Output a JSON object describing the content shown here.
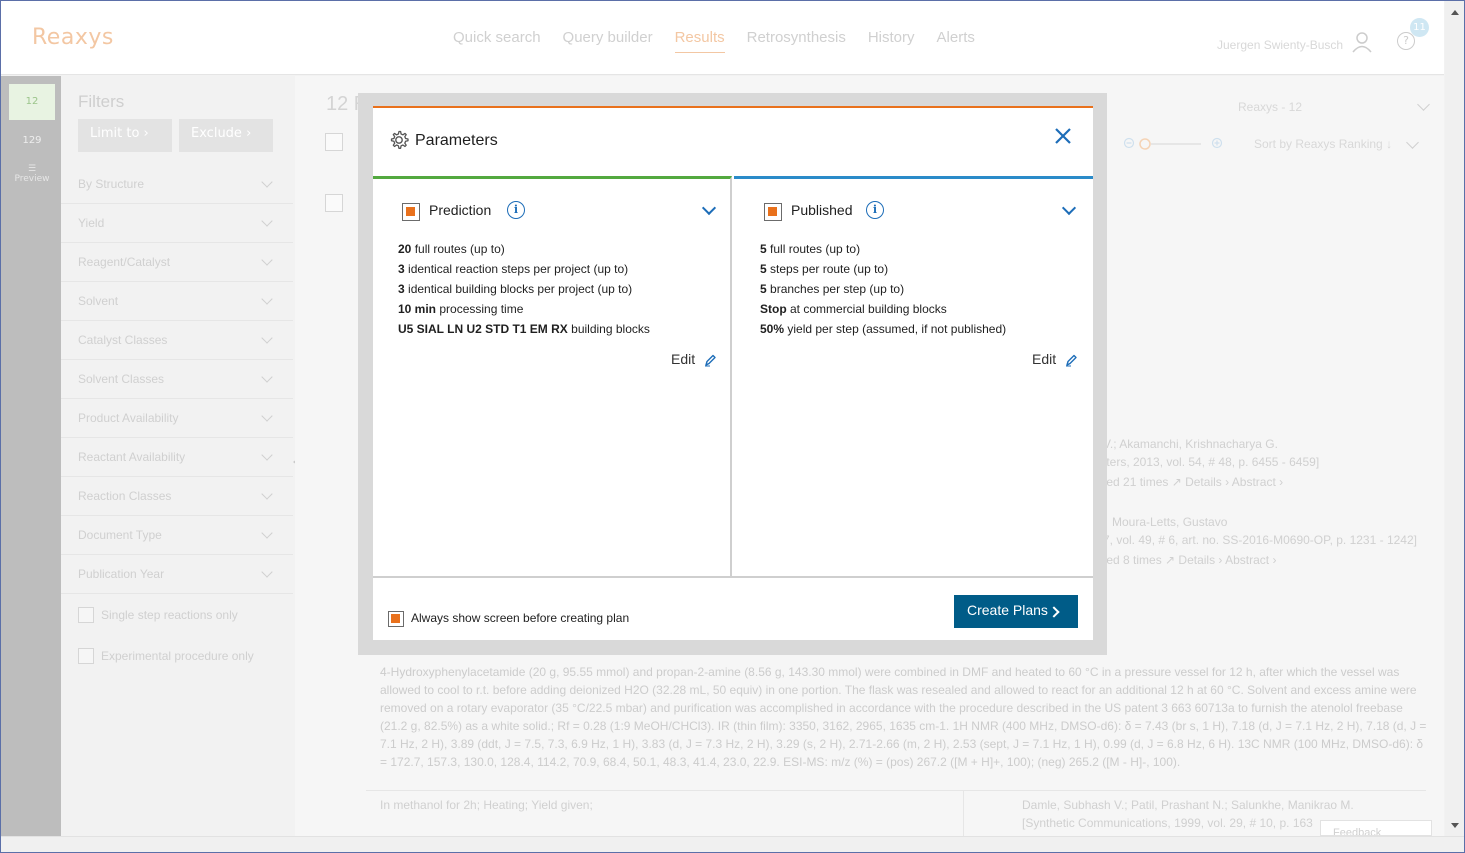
{
  "header": {
    "logo": "Reaxys",
    "nav": [
      "Quick search",
      "Query builder",
      "Results",
      "Retrosynthesis",
      "History",
      "Alerts"
    ],
    "active_nav": "Results",
    "user_name": "Juergen Swienty-Busch",
    "notification_count": "11"
  },
  "rail": {
    "tab1": "12",
    "tab2": "129",
    "preview": "Preview"
  },
  "filters": {
    "title": "Filters",
    "limit_button": "Limit to",
    "exclude_button": "Exclude",
    "items": [
      "By Structure",
      "Yield",
      "Reagent/Catalyst",
      "Solvent",
      "Catalyst Classes",
      "Solvent Classes",
      "Product Availability",
      "Reactant Availability",
      "Reaction Classes",
      "Document Type",
      "Publication Year"
    ],
    "checkboxes": [
      "Single step reactions only",
      "Experimental procedure only"
    ]
  },
  "results": {
    "count": "12 R",
    "source_select": "Reaxys - 12",
    "sort": "Sort by Reaxys Ranking",
    "authors1": "V.; Akamanchi, Krishnacharya G.",
    "citation1": "tters, 2013, vol. 54, # 48, p. 6455 - 6459]",
    "links1": "ted 21 times ↗    Details ›    Abstract ›",
    "authors2": "Moura-Letts, Gustavo",
    "citation2": "7, vol. 49, # 6, art. no. SS-2016-M0690-OP, p. 1231 - 1242]",
    "links2": "ted 8 times ↗    Details ›    Abstract ›",
    "procedure": "4-Hydroxyphenylacetamide (20 g, 95.55 mmol) and propan-2-amine (8.56 g, 143.30 mmol) were combined in DMF and heated to 60 °C in a pressure vessel for 12 h, after which the vessel was allowed to cool to r.t. before adding deionized H2O (32.28 mL, 50 equiv) in one portion. The flask was resealed and allowed to react for an additional 12 h at 60 °C. Solvent and excess amine were removed on a rotary evaporator (35 °C/22.5 mbar) and purification was accomplished in accordance with the procedure described in the US patent 3 663 60713a to furnish the atenolol freebase (21.2 g, 82.5%) as a white solid.; Rf = 0.28 (1:9 MeOH/CHCl3). IR (thin film): 3350, 3162, 2965, 1635 cm-1. 1H NMR (400 MHz, DMSO-d6): δ = 7.43 (br s, 1 H), 7.18 (d, J = 7.1 Hz, 2 H), 7.18 (d, J = 7.1 Hz, 2 H), 3.89 (ddt, J = 7.5, 7.3, 6.9 Hz, 1 H), 3.83 (d, J = 7.3 Hz, 2 H), 3.29 (s, 2 H), 2.71-2.66 (m, 2 H), 2.53 (sept, J = 7.1 Hz, 1 H), 0.99 (d, J = 6.8 Hz, 6 H). 13C NMR (100 MHz, DMSO-d6): δ = 172.7, 157.3, 130.0, 128.4, 114.2, 70.9, 68.4, 50.1, 48.3, 41.4, 23.0, 22.9. ESI-MS: m/z (%) = (pos) 267.2 ([M + H]+, 100); (neg) 265.2 ([M - H]-, 100).",
    "conditions": "In methanol for 2h; Heating; Yield given;",
    "authors3": "Damle, Subhash V.; Patil, Prashant N.; Salunkhe, Manikrao M.",
    "citation3": "[Synthetic Communications, 1999, vol. 29, # 10, p. 163",
    "feedback": "Feedback"
  },
  "modal": {
    "title": "Parameters",
    "prediction": {
      "title": "Prediction",
      "lines": [
        {
          "bold": "20",
          "text": " full routes (up to)"
        },
        {
          "bold": "3",
          "text": " identical reaction steps per project (up to)"
        },
        {
          "bold": "3",
          "text": " identical building blocks per project (up to)"
        },
        {
          "bold": "10 min",
          "text": " processing time"
        },
        {
          "bold": "U5 SIAL LN U2 STD T1 EM RX",
          "text": " building blocks"
        }
      ],
      "edit": "Edit"
    },
    "published": {
      "title": "Published",
      "lines": [
        {
          "bold": "5",
          "text": " full routes (up to)"
        },
        {
          "bold": "5",
          "text": " steps per route (up to)"
        },
        {
          "bold": "5",
          "text": " branches per step (up to)"
        },
        {
          "bold": "Stop",
          "text": " at commercial building blocks"
        },
        {
          "bold": "50%",
          "text": " yield per step (assumed, if not published)"
        }
      ],
      "edit": "Edit"
    },
    "footer_checkbox": "Always show screen before creating plan",
    "create_button": "Create Plans"
  },
  "colors": {
    "accent_orange": "#e9711c",
    "prediction_green": "#53a93f",
    "published_blue": "#2a8bc9",
    "button_blue": "#005c88",
    "link_blue": "#1d6db8"
  }
}
